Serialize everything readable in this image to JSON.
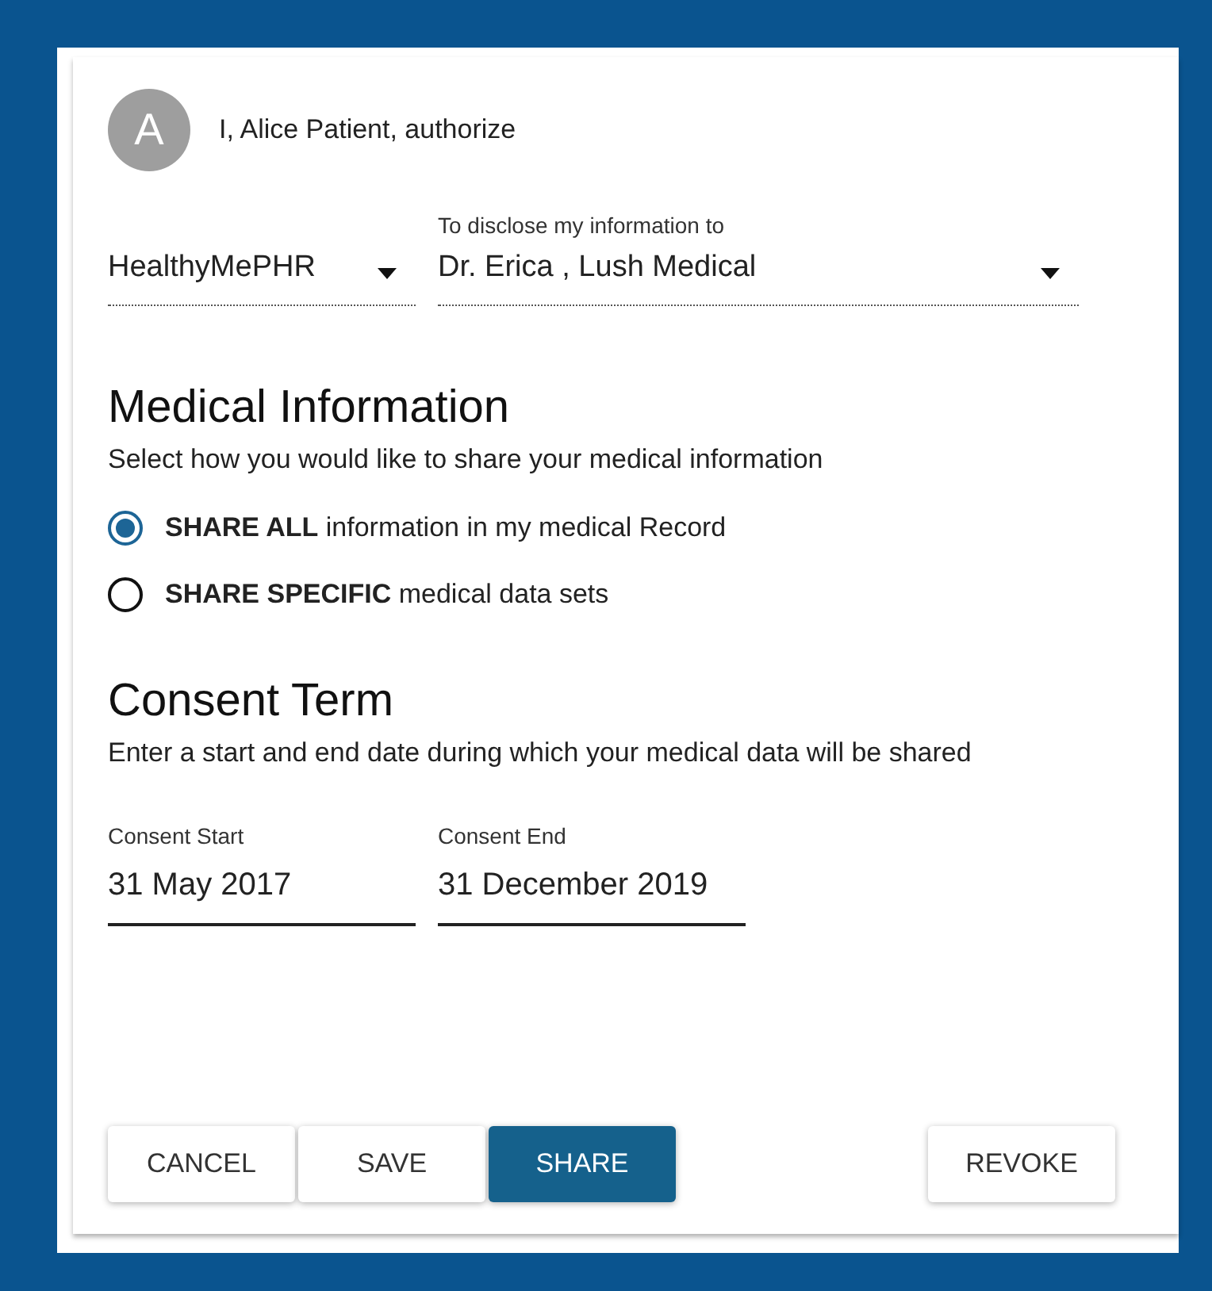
{
  "header": {
    "avatar": "A",
    "text": "I, Alice Patient, authorize"
  },
  "selectors": [
    {
      "value": "HealthyMePHR"
    },
    {
      "label": "To disclose my information to",
      "value": "Dr. Erica , Lush Medical"
    }
  ],
  "medical_information": {
    "title": "Medical Information",
    "subtitle": "Select how you would like to share your medical information",
    "options": [
      {
        "label": "**SHARE ALL** information in my medical Record",
        "selected": true
      },
      {
        "label": "**SHARE SPECIFIC** medical data sets",
        "selected": false
      }
    ]
  },
  "consent_term": {
    "title": "Consent Term",
    "subtitle": "Enter a start and end date during which your medical data will be shared",
    "fields": [
      {
        "label": "Consent Start",
        "value": "31 May 2017"
      },
      {
        "label": "Consent End",
        "value": "31 December 2019"
      }
    ]
  },
  "buttons": [
    {
      "label": "CANCEL",
      "kind": "default"
    },
    {
      "label": "SAVE",
      "kind": "default"
    },
    {
      "label": "SHARE",
      "kind": "primary"
    },
    {
      "label": "REVOKE",
      "kind": "default"
    }
  ]
}
